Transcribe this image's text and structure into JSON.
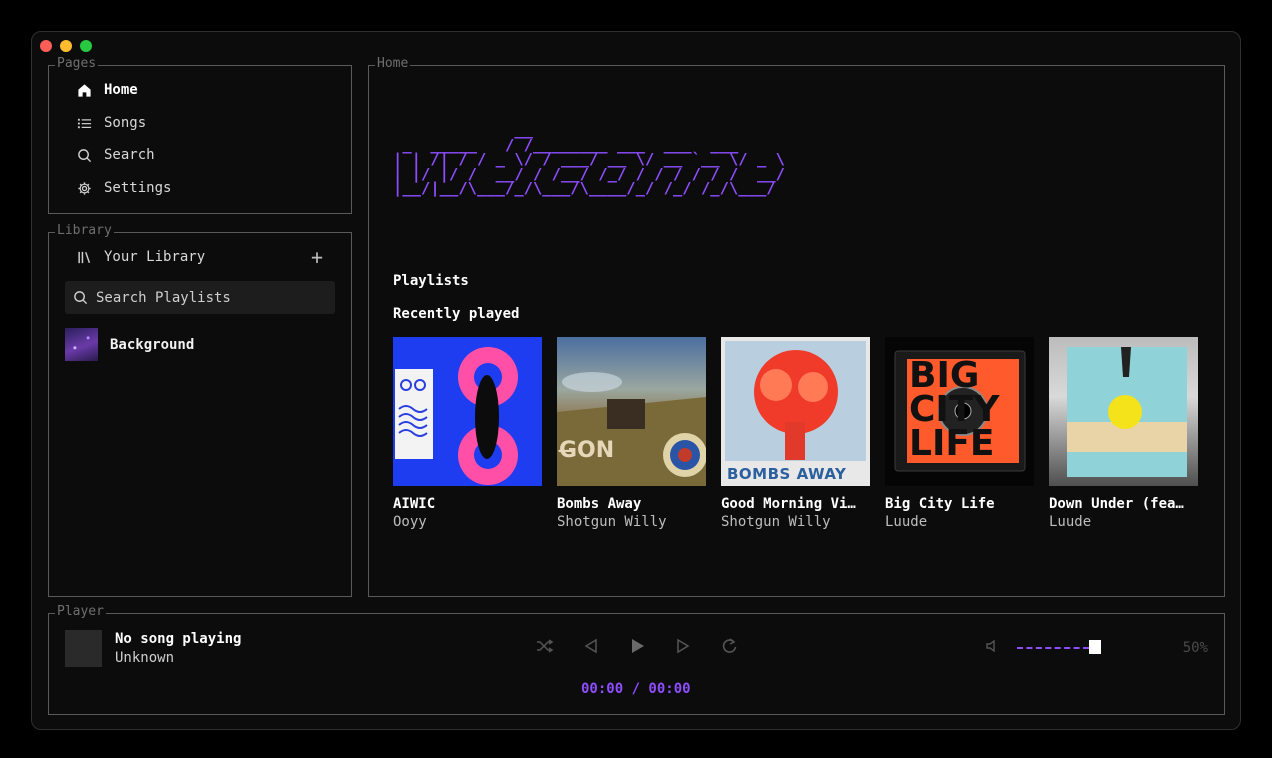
{
  "pages": {
    "title": "Pages",
    "items": [
      {
        "label": "Home",
        "icon": "home-icon",
        "active": true
      },
      {
        "label": "Songs",
        "icon": "list-icon",
        "active": false
      },
      {
        "label": "Search",
        "icon": "search-icon",
        "active": false
      },
      {
        "label": "Settings",
        "icon": "gear-icon",
        "active": false
      }
    ]
  },
  "library": {
    "title": "Library",
    "header": "Your Library",
    "add_label": "+",
    "search_placeholder": "Search Playlists",
    "playlists": [
      {
        "name": "Background"
      }
    ]
  },
  "home": {
    "title": "Home",
    "welcome_ascii": "             __\n _  _____   / /________ ___  ___  ___\n| | /| / / _ \\/ / ___/ __ \\/ __ `__ \\/ _ \\\n| |/ |/ /  __/ / /__/ /_/ / / / / / /  __/\n|__/|__/\\___/_/\\___/\\____/_/ /_/ /_/\\___/",
    "playlists_heading": "Playlists",
    "recent_heading": "Recently played",
    "recent": [
      {
        "title": "AIWIC",
        "artist": "Ooyy"
      },
      {
        "title": "Bombs Away",
        "artist": "Shotgun Willy"
      },
      {
        "title": "Good Morning Vi…",
        "artist": "Shotgun Willy"
      },
      {
        "title": "Big City Life",
        "artist": "Luude"
      },
      {
        "title": "Down Under (fea…",
        "artist": "Luude"
      }
    ]
  },
  "player": {
    "title": "Player",
    "song": "No song playing",
    "artist": "Unknown",
    "time": "00:00 / 00:00",
    "volume_percent": "50%",
    "volume_level": 0.5
  },
  "colors": {
    "accent": "#8e4dff",
    "background": "#0c0c0c",
    "border": "#5a5a5a"
  }
}
